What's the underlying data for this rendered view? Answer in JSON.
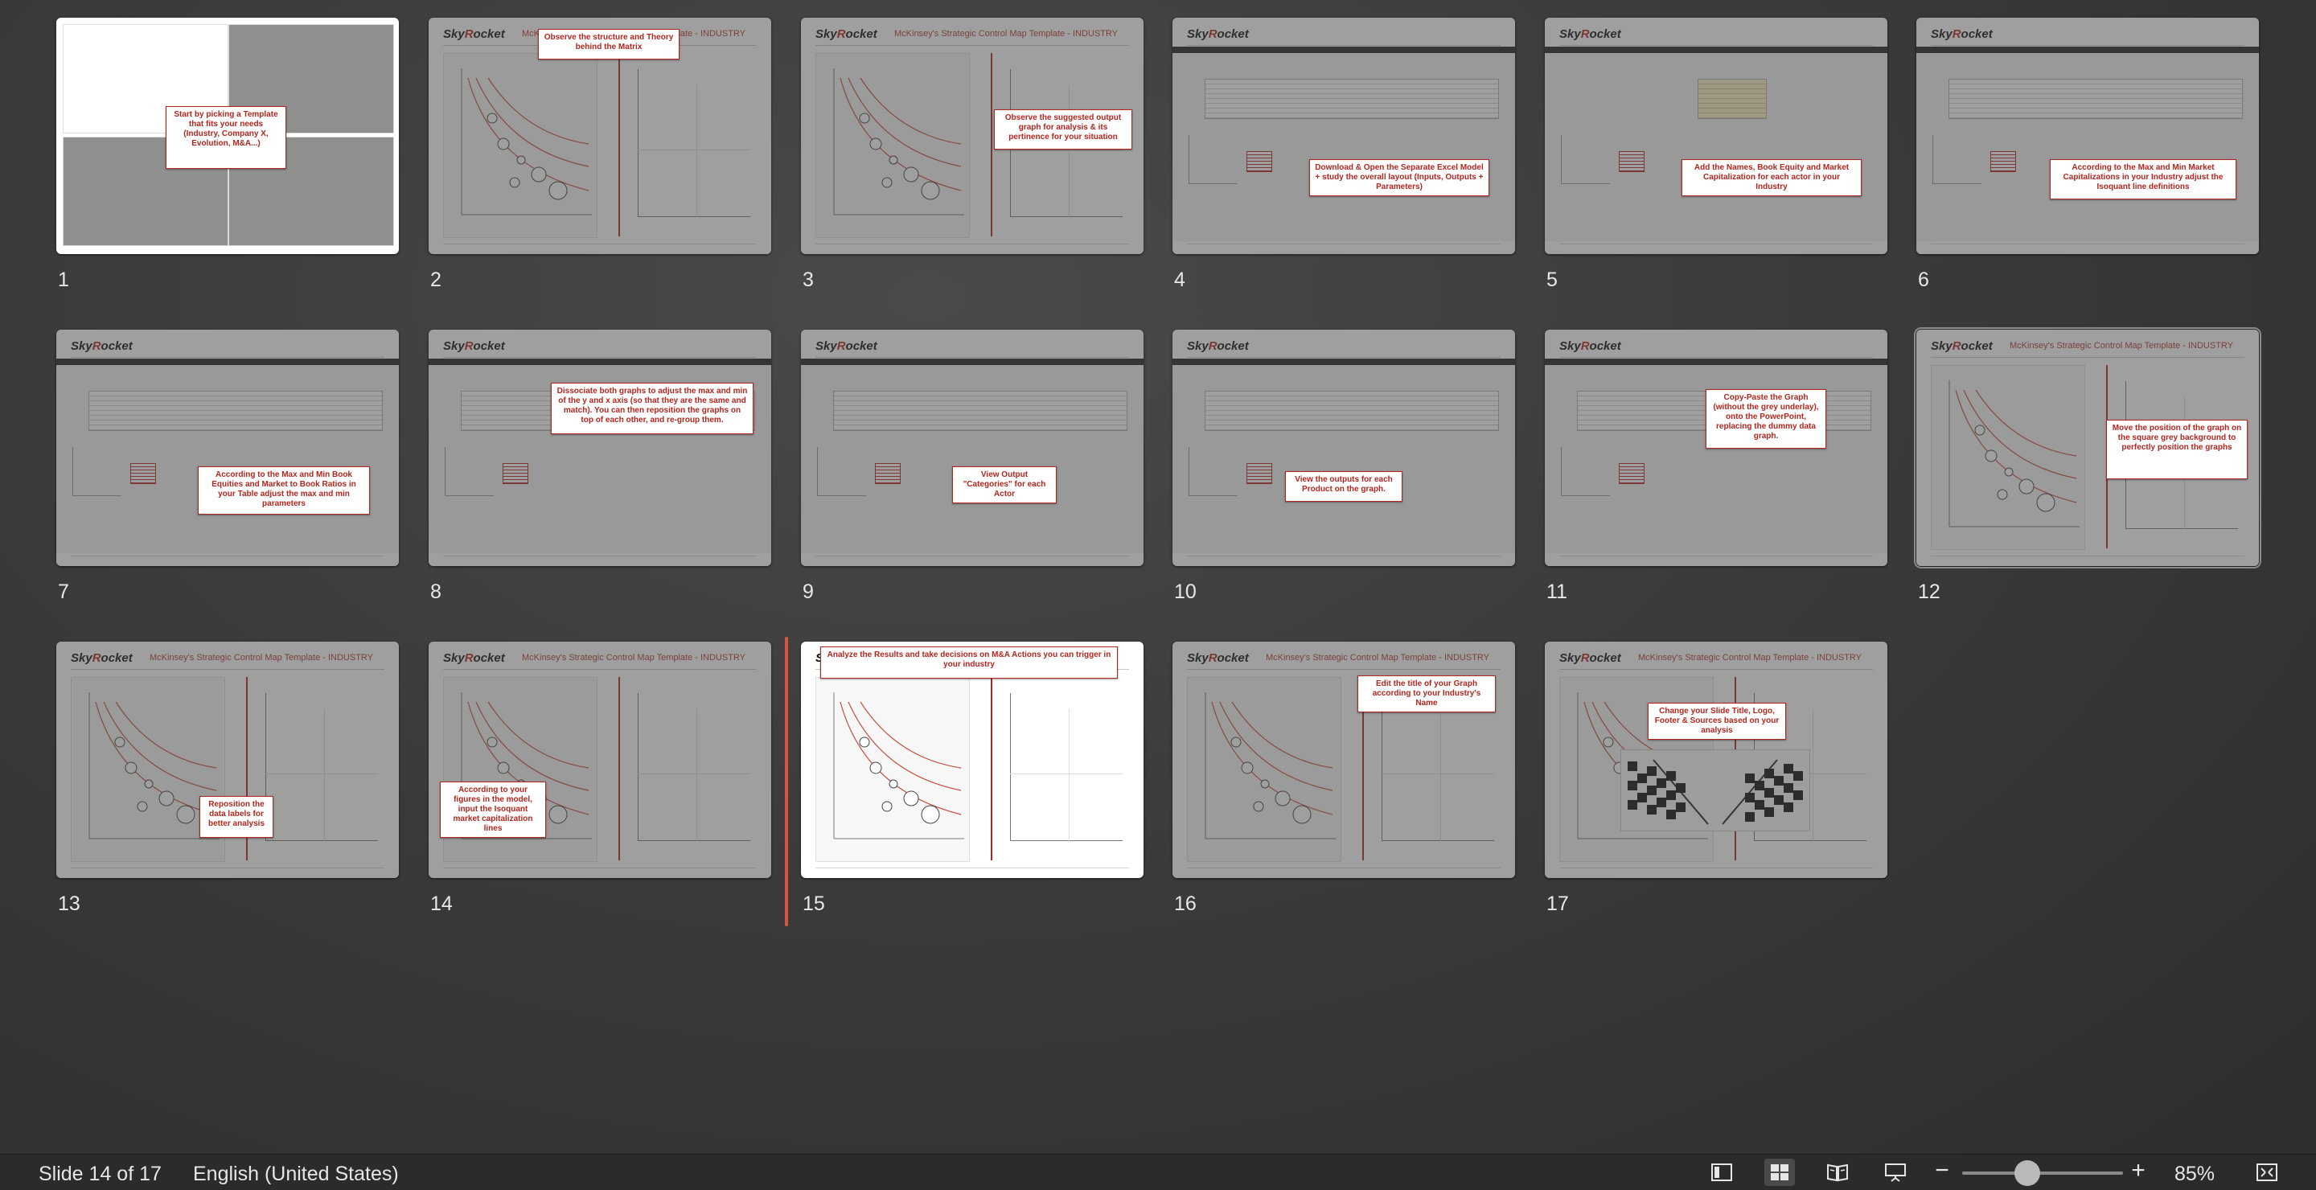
{
  "slides": [
    {
      "num": "1",
      "kind": "collage",
      "callout": "Start by picking a Template that fits your needs (Industry, Company X, Evolution, M&A...)"
    },
    {
      "num": "2",
      "kind": "chart",
      "callout": "Observe the structure and Theory behind the Matrix"
    },
    {
      "num": "3",
      "kind": "chart",
      "callout": "Observe the suggested output graph for analysis & its pertinence for your situation"
    },
    {
      "num": "4",
      "kind": "sheet",
      "callout": "Download & Open the Separate Excel Model + study the overall layout (Inputs, Outputs + Parameters)"
    },
    {
      "num": "5",
      "kind": "sheet-yellow",
      "callout": "Add the Names, Book Equity and Market Capitalization for each actor in your Industry"
    },
    {
      "num": "6",
      "kind": "sheet",
      "callout": "According to the Max and Min Market Capitalizations in your Industry adjust the Isoquant line definitions"
    },
    {
      "num": "7",
      "kind": "sheet",
      "callout": "According to the Max and Min Book Equities and Market to Book Ratios in your Table adjust the max and min parameters"
    },
    {
      "num": "8",
      "kind": "sheet",
      "callout": "Dissociate both graphs to adjust the max and min of the y and x axis (so that they are the same and match). You can then reposition the graphs on top of each other, and re-group them."
    },
    {
      "num": "9",
      "kind": "sheet",
      "callout": "View Output \"Categories\" for each Actor"
    },
    {
      "num": "10",
      "kind": "sheet",
      "callout": "View the outputs for each Product on the graph."
    },
    {
      "num": "11",
      "kind": "sheet",
      "callout": "Copy-Paste the Graph (without the grey underlay), onto the PowerPoint, replacing the dummy data graph."
    },
    {
      "num": "12",
      "kind": "chart",
      "callout": "Move the position of the graph on the square grey background to perfectly position the graphs"
    },
    {
      "num": "13",
      "kind": "chart",
      "callout": "Reposition the data labels for better analysis"
    },
    {
      "num": "14",
      "kind": "chart",
      "callout": "According to your figures in the model, input the Isoquant market capitalization lines"
    },
    {
      "num": "15",
      "kind": "chart",
      "callout": "Analyze the Results and take decisions on M&A Actions you can trigger in your industry"
    },
    {
      "num": "16",
      "kind": "chart",
      "callout": "Edit the title of your Graph according to your Industry's Name"
    },
    {
      "num": "17",
      "kind": "flags",
      "callout": "Change your Slide Title, Logo, Footer & Sources based on your analysis"
    }
  ],
  "thumb": {
    "logo_a": "Sky",
    "logo_b": "R",
    "logo_c": "ocket",
    "title": "McKinsey's Strategic Control Map Template - INDUSTRY"
  },
  "statusbar": {
    "slide_position": "Slide 14 of 17",
    "language": "English (United States)",
    "zoom_minus": "−",
    "zoom_plus": "+",
    "zoom_level": "85%"
  },
  "colors": {
    "accent": "#b3261e",
    "insertion_marker": "#d9543f"
  }
}
